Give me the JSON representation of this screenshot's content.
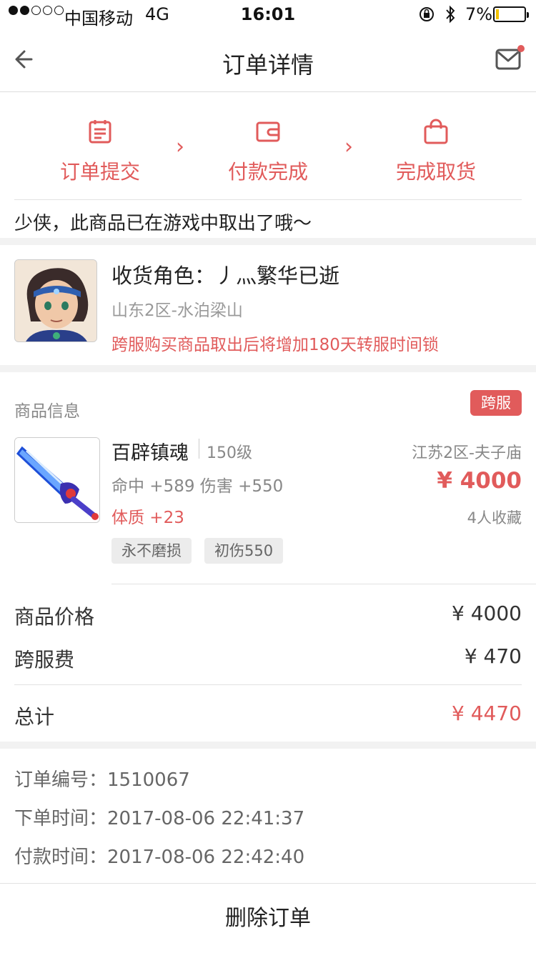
{
  "status_bar": {
    "carrier": "中国移动",
    "network": "4G",
    "time": "16:01",
    "battery": "7%"
  },
  "nav": {
    "title": "订单详情"
  },
  "steps": [
    {
      "label": "订单提交",
      "icon": "clipboard-icon"
    },
    {
      "label": "付款完成",
      "icon": "wallet-icon"
    },
    {
      "label": "完成取货",
      "icon": "shopping-bag-icon"
    }
  ],
  "notice": "少侠，此商品已在游戏中取出了哦～",
  "receiver": {
    "name": "收货角色：丿灬繁华已逝",
    "server": "山东2区-水泊梁山",
    "warning": "跨服购买商品取出后将增加180天转服时间锁"
  },
  "product": {
    "section_label": "商品信息",
    "badge": "跨服",
    "name": "百辟镇魂",
    "level": "150级",
    "server": "江苏2区-夫子庙",
    "attr1": "命中 +589 伤害 +550",
    "price": "¥ 4000",
    "attr2": "体质 +23",
    "favorites": "4人收藏",
    "tags": [
      "永不磨损",
      "初伤550"
    ]
  },
  "fees": {
    "price_label": "商品价格",
    "price_value": "¥ 4000",
    "cross_label": "跨服费",
    "cross_value": "¥ 470",
    "total_label": "总计",
    "total_value": "¥ 4470"
  },
  "order_info": {
    "number": "订单编号：1510067",
    "created": "下单时间：2017-08-06 22:41:37",
    "paid": "付款时间：2017-08-06 22:42:40"
  },
  "actions": {
    "delete": "删除订单"
  },
  "colors": {
    "accent": "#e15b5b",
    "gray_text": "#888888"
  }
}
